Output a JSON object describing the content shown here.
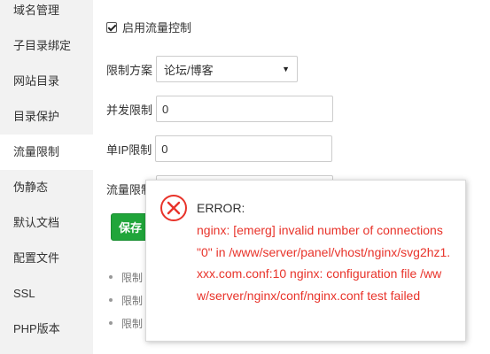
{
  "sidebar": {
    "items": [
      {
        "label": "域名管理"
      },
      {
        "label": "子目录绑定"
      },
      {
        "label": "网站目录"
      },
      {
        "label": "目录保护"
      },
      {
        "label": "流量限制",
        "active": true
      },
      {
        "label": "伪静态"
      },
      {
        "label": "默认文档"
      },
      {
        "label": "配置文件"
      },
      {
        "label": "SSL"
      },
      {
        "label": "PHP版本"
      }
    ]
  },
  "form": {
    "enable_label": "启用流量控制",
    "enable_checked": true,
    "scheme_label": "限制方案",
    "scheme_value": "论坛/博客",
    "concurrency_label": "并发限制",
    "concurrency_value": "0",
    "per_ip_label": "单IP限制",
    "per_ip_value": "0",
    "flow_label": "流量限制",
    "save_label": "保存"
  },
  "notes": [
    "限制",
    "限制",
    "限制"
  ],
  "error": {
    "title": "ERROR:",
    "message": "nginx: [emerg] invalid number of connections \"0\" in /www/server/panel/vhost/nginx/svg2hz1.xxx.com.conf:10 nginx: configuration file /www/server/nginx/conf/nginx.conf test failed",
    "color": "#e8332a"
  },
  "colors": {
    "accent": "#20a53a",
    "sidebar_bg": "#f2f2f2"
  },
  "icons": {
    "error": "error-circle-x-icon",
    "check": "checkmark-icon",
    "caret": "caret-down-icon"
  }
}
